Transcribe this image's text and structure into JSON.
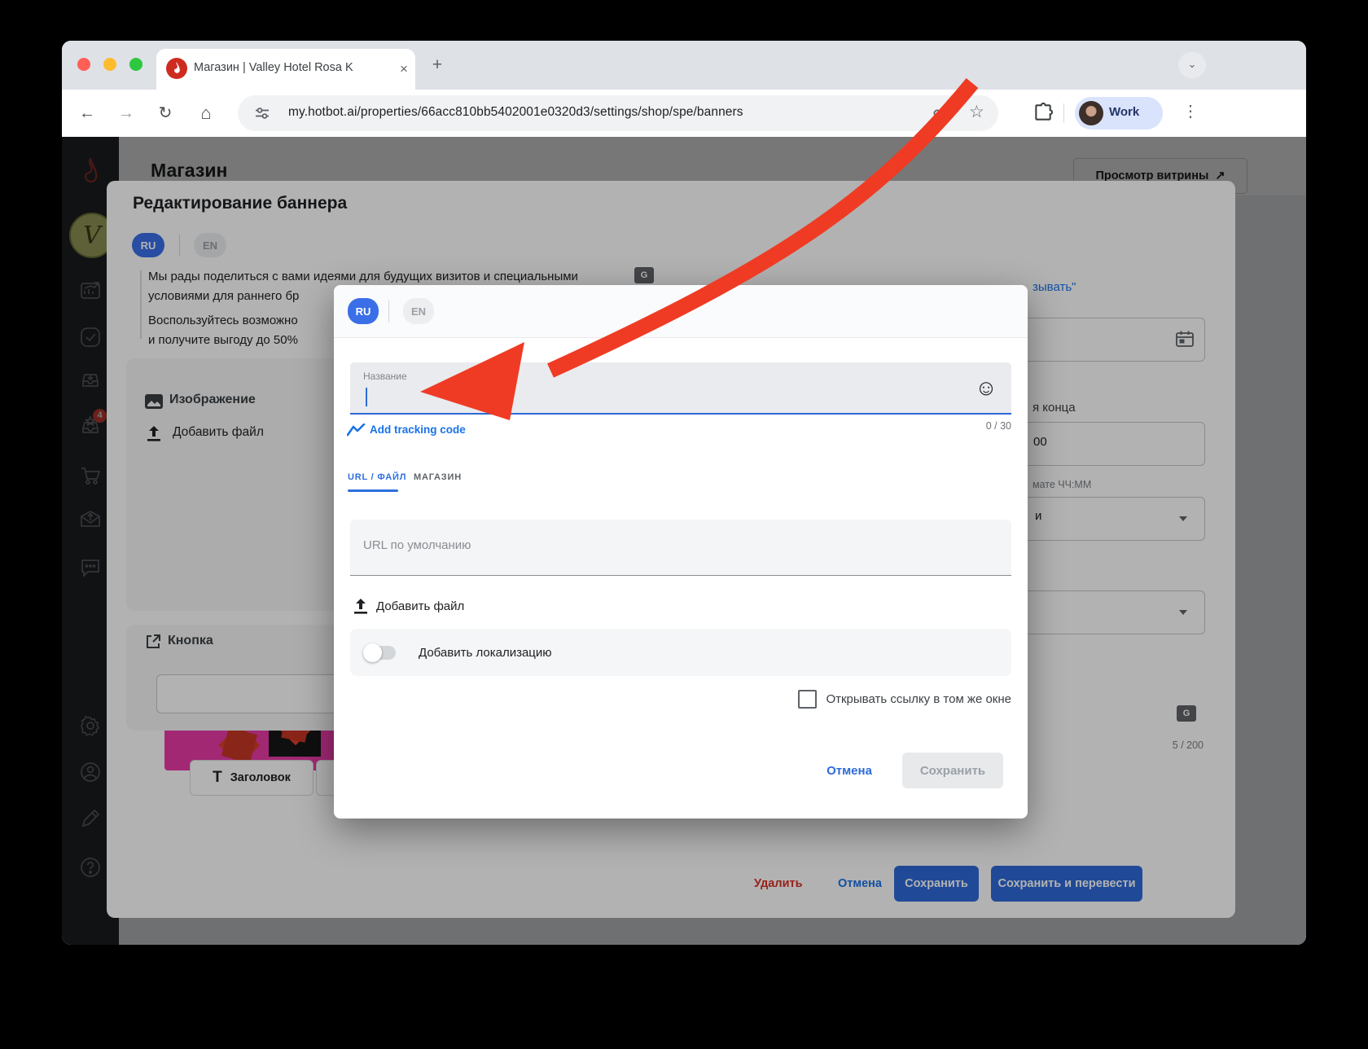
{
  "browser": {
    "tab_title": "Магазин | Valley Hotel Rosa K",
    "new_tab": "+",
    "url": "my.hotbot.ai/properties/66acc810bb5402001e0320d3/settings/shop/spe/banners",
    "profile_label": "Work"
  },
  "sidebar": {
    "icons": [
      "flame-logo",
      "hotel-avatar",
      "analytics",
      "tasks",
      "inbox-download",
      "loyalty",
      "cart",
      "campaign-mail",
      "chat",
      "settings",
      "account",
      "editor-pencil",
      "help"
    ],
    "loyalty_badge": "4"
  },
  "page": {
    "title": "Магазин",
    "preview_button": "Просмотр витрины"
  },
  "editor": {
    "title": "Редактирование баннера",
    "lang_ru": "RU",
    "lang_en": "EN",
    "paragraph1_line1": "Мы рады поделиться с вами идеями для будущих визитов и специальными",
    "paragraph1_line2": "условиями для раннего бр",
    "paragraph2_line1": "Воспользуйтесь возможно",
    "paragraph2_line2": "и получите выгоду до 50%",
    "image_section": {
      "title": "Изображение",
      "add_file": "Добавить файл"
    },
    "button_section": {
      "title": "Кнопка"
    },
    "heading_button": "Заголовок",
    "right_column": {
      "link_fragment": "зывать\"",
      "end_label_fragment": "я конца",
      "time_value_fragment": "00",
      "time_hint_fragment": "мате ЧЧ:ММ",
      "dropdown_fragment": "и",
      "counter": "5 / 200"
    },
    "footer": {
      "delete": "Удалить",
      "cancel": "Отмена",
      "save": "Сохранить",
      "save_translate": "Сохранить и перевести"
    }
  },
  "dialog": {
    "lang_ru": "RU",
    "lang_en": "EN",
    "name_field": {
      "label": "Название",
      "counter": "0 / 30"
    },
    "tracking_link": "Add tracking code",
    "tabs": {
      "url_file": "URL / ФАЙЛ",
      "shop": "МАГАЗИН"
    },
    "url_field_placeholder": "URL по умолчанию",
    "add_file": "Добавить файл",
    "localization_toggle": "Добавить локализацию",
    "checkbox_label": "Открывать ссылку в том же окне",
    "cancel": "Отмена",
    "save": "Сохранить"
  },
  "colors": {
    "accent_blue": "#2e6bd8",
    "link_blue": "#1a73e8",
    "arrow_red": "#ef3b24",
    "danger_red": "#d93025",
    "pill_blue": "#3a6fe8"
  }
}
